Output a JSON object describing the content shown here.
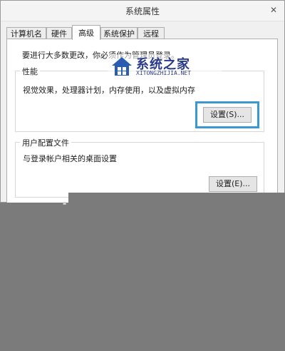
{
  "window": {
    "title": "系统属性",
    "close_glyph": "✕"
  },
  "tabs": [
    {
      "label": "计算机名"
    },
    {
      "label": "硬件"
    },
    {
      "label": "高级"
    },
    {
      "label": "系统保护"
    },
    {
      "label": "远程"
    }
  ],
  "active_tab": "高级",
  "notice": "要进行大多数更改，你必须作为管理员登录。",
  "performance": {
    "title": "性能",
    "description": "视觉效果，处理器计划，内存使用，以及虚拟内存",
    "button_label": "设置(S)..."
  },
  "user_profiles": {
    "title": "用户配置文件",
    "description": "与登录帐户相关的桌面设置",
    "button_label": "设置(E)..."
  },
  "watermark": {
    "text": "系统之家",
    "subtext": "XITONGZHIJIA.NET"
  },
  "colors": {
    "highlight": "#3c98d0",
    "overlay": "#7b7b7b"
  }
}
